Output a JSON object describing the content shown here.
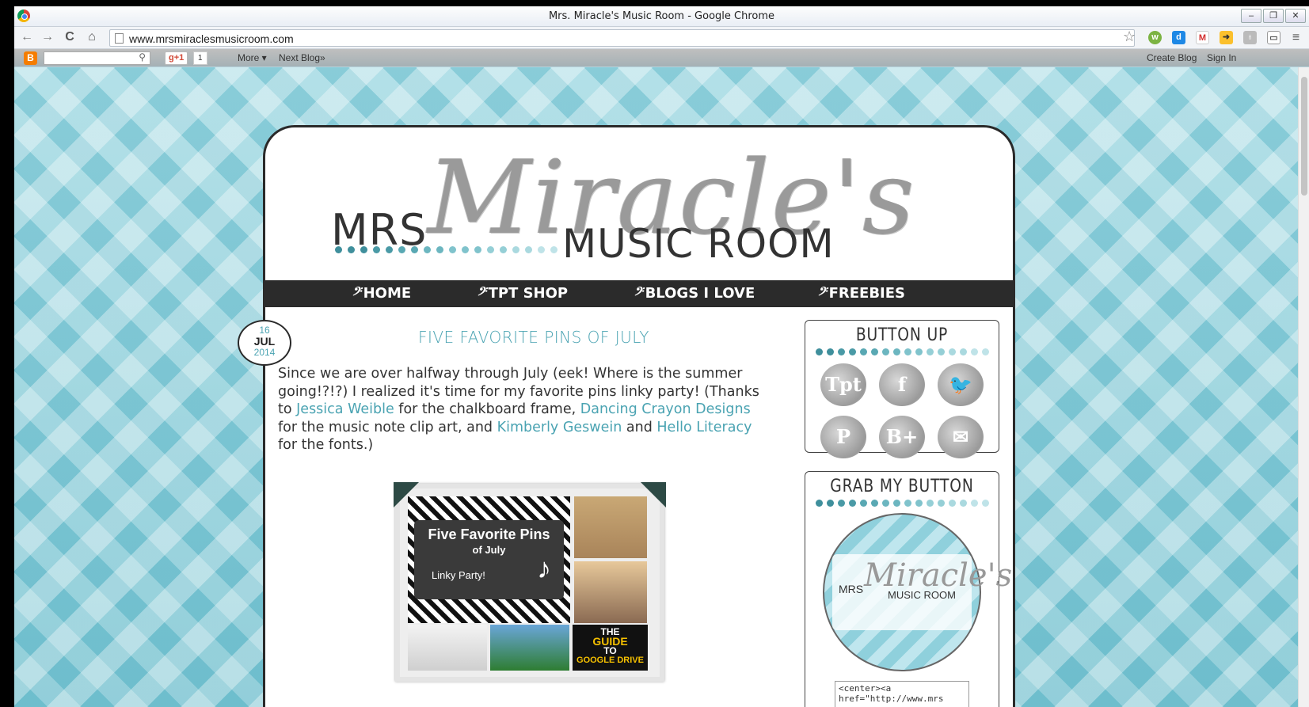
{
  "window": {
    "title": "Mrs. Miracle's Music Room - Google Chrome"
  },
  "browser": {
    "url": "www.mrsmiraclesmusicroom.com",
    "nav": {
      "back": "←",
      "forward": "→",
      "reload": "C",
      "home": "⌂"
    }
  },
  "blogger_bar": {
    "plus_one": "g+1",
    "plus_count": "1",
    "more": "More ▾",
    "next_blog": "Next Blog»",
    "create_blog": "Create Blog",
    "sign_in": "Sign In"
  },
  "header": {
    "mrs": "MRS",
    "script": "Miracle's",
    "music_room": "MUSIC ROOM",
    "dot_colors": [
      "#3f8f9c",
      "#4a9aa6",
      "#59a8b3",
      "#6cb6c0",
      "#80c3cc",
      "#95cfd6",
      "#aad9df",
      "#bfe3e8"
    ]
  },
  "nav": {
    "clef": "𝄢",
    "items": [
      "HOME",
      "TPT SHOP",
      "BLOGS I LOVE",
      "FREEBIES"
    ]
  },
  "post": {
    "date_day": "16",
    "date_month": "JUL",
    "date_year": "2014",
    "title": "FIVE FAVORITE PINS OF JULY",
    "body_1": "Since we are over halfway through July (eek! Where is the summer going!?!?) I realized it's time for my favorite pins linky party! (Thanks to ",
    "link_1": "Jessica Weible",
    "body_2": " for the chalkboard frame, ",
    "link_2": "Dancing Crayon Designs",
    "body_3": " for the music note clip art, and ",
    "link_3": "Kimberly Geswein",
    "body_4": " and ",
    "link_4": "Hello Literacy",
    "body_5": " for the fonts.)",
    "image": {
      "line1": "Five Favorite Pins",
      "line2": "of July",
      "line3": "Linky Party!",
      "guide_1": "THE",
      "guide_2": "GUIDE",
      "guide_3": "TO",
      "guide_4": "GOOGLE DRIVE"
    }
  },
  "sidebar": {
    "button_up_title": "BUTTON UP",
    "social": [
      {
        "name": "tpt-icon",
        "glyph": "Tpt"
      },
      {
        "name": "facebook-icon",
        "glyph": "f"
      },
      {
        "name": "twitter-icon",
        "glyph": "🐦"
      },
      {
        "name": "pinterest-icon",
        "glyph": "P"
      },
      {
        "name": "bloglovin-icon",
        "glyph": "B+"
      },
      {
        "name": "email-icon",
        "glyph": "✉"
      }
    ],
    "grab_title": "GRAB MY BUTTON",
    "grab_mrs": "MRS",
    "grab_script": "Miracle's",
    "grab_room": "MUSIC ROOM",
    "code_line_1": "<center><a",
    "code_line_2": "href=\"http://www.mrs"
  },
  "colors": {
    "accent": "#4aa3b2",
    "nav_bg": "#2b2b2b",
    "page_bg": "#9fd6e0"
  }
}
